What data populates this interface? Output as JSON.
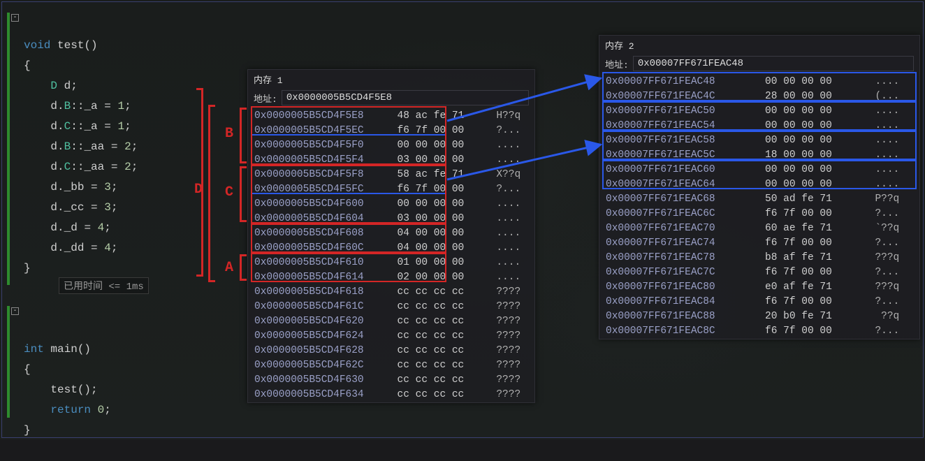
{
  "code": {
    "fn1_sig_kw": "void",
    "fn1_sig_name": "test",
    "lines": [
      "D d;",
      "d.B::_a = 1;",
      "d.C::_a = 1;",
      "d.B::_aa = 2;",
      "d.C::_aa = 2;",
      "d._bb = 3;",
      "d._cc = 3;",
      "d._d = 4;",
      "d._dd = 4;"
    ],
    "fn2_sig_kw": "int",
    "fn2_sig_name": "main",
    "main_call": "test();",
    "main_ret_kw": "return",
    "main_ret_val": "0",
    "timing": "已用时间 <= 1ms"
  },
  "labels": {
    "B": "B",
    "C": "C",
    "D": "D",
    "A": "A"
  },
  "mem1": {
    "title": "内存 1",
    "addr_label": "地址:",
    "addr_value": "0x0000005B5CD4F5E8",
    "rows": [
      {
        "a": "0x0000005B5CD4F5E8",
        "b": "48 ac fe 71",
        "s": "H??q"
      },
      {
        "a": "0x0000005B5CD4F5EC",
        "b": "f6 7f 00 00",
        "s": "?..."
      },
      {
        "a": "0x0000005B5CD4F5F0",
        "b": "00 00 00 00",
        "s": "...."
      },
      {
        "a": "0x0000005B5CD4F5F4",
        "b": "03 00 00 00",
        "s": "...."
      },
      {
        "a": "0x0000005B5CD4F5F8",
        "b": "58 ac fe 71",
        "s": "X??q"
      },
      {
        "a": "0x0000005B5CD4F5FC",
        "b": "f6 7f 00 00",
        "s": "?..."
      },
      {
        "a": "0x0000005B5CD4F600",
        "b": "00 00 00 00",
        "s": "...."
      },
      {
        "a": "0x0000005B5CD4F604",
        "b": "03 00 00 00",
        "s": "...."
      },
      {
        "a": "0x0000005B5CD4F608",
        "b": "04 00 00 00",
        "s": "...."
      },
      {
        "a": "0x0000005B5CD4F60C",
        "b": "04 00 00 00",
        "s": "...."
      },
      {
        "a": "0x0000005B5CD4F610",
        "b": "01 00 00 00",
        "s": "...."
      },
      {
        "a": "0x0000005B5CD4F614",
        "b": "02 00 00 00",
        "s": "...."
      },
      {
        "a": "0x0000005B5CD4F618",
        "b": "cc cc cc cc",
        "s": "????"
      },
      {
        "a": "0x0000005B5CD4F61C",
        "b": "cc cc cc cc",
        "s": "????"
      },
      {
        "a": "0x0000005B5CD4F620",
        "b": "cc cc cc cc",
        "s": "????"
      },
      {
        "a": "0x0000005B5CD4F624",
        "b": "cc cc cc cc",
        "s": "????"
      },
      {
        "a": "0x0000005B5CD4F628",
        "b": "cc cc cc cc",
        "s": "????"
      },
      {
        "a": "0x0000005B5CD4F62C",
        "b": "cc cc cc cc",
        "s": "????"
      },
      {
        "a": "0x0000005B5CD4F630",
        "b": "cc cc cc cc",
        "s": "????"
      },
      {
        "a": "0x0000005B5CD4F634",
        "b": "cc cc cc cc",
        "s": "????"
      }
    ]
  },
  "mem2": {
    "title": "内存 2",
    "addr_label": "地址:",
    "addr_value": "0x00007FF671FEAC48",
    "rows": [
      {
        "a": "0x00007FF671FEAC48",
        "b": "00 00 00 00",
        "s": "...."
      },
      {
        "a": "0x00007FF671FEAC4C",
        "b": "28 00 00 00",
        "s": "(..."
      },
      {
        "a": "0x00007FF671FEAC50",
        "b": "00 00 00 00",
        "s": "...."
      },
      {
        "a": "0x00007FF671FEAC54",
        "b": "00 00 00 00",
        "s": "...."
      },
      {
        "a": "0x00007FF671FEAC58",
        "b": "00 00 00 00",
        "s": "...."
      },
      {
        "a": "0x00007FF671FEAC5C",
        "b": "18 00 00 00",
        "s": "...."
      },
      {
        "a": "0x00007FF671FEAC60",
        "b": "00 00 00 00",
        "s": "...."
      },
      {
        "a": "0x00007FF671FEAC64",
        "b": "00 00 00 00",
        "s": "...."
      },
      {
        "a": "0x00007FF671FEAC68",
        "b": "50 ad fe 71",
        "s": "P??q"
      },
      {
        "a": "0x00007FF671FEAC6C",
        "b": "f6 7f 00 00",
        "s": "?..."
      },
      {
        "a": "0x00007FF671FEAC70",
        "b": "60 ae fe 71",
        "s": "`??q"
      },
      {
        "a": "0x00007FF671FEAC74",
        "b": "f6 7f 00 00",
        "s": "?..."
      },
      {
        "a": "0x00007FF671FEAC78",
        "b": "b8 af fe 71",
        "s": "???q"
      },
      {
        "a": "0x00007FF671FEAC7C",
        "b": "f6 7f 00 00",
        "s": "?..."
      },
      {
        "a": "0x00007FF671FEAC80",
        "b": "e0 af fe 71",
        "s": "???q"
      },
      {
        "a": "0x00007FF671FEAC84",
        "b": "f6 7f 00 00",
        "s": "?..."
      },
      {
        "a": "0x00007FF671FEAC88",
        "b": "20 b0 fe 71",
        "s": " ??q"
      },
      {
        "a": "0x00007FF671FEAC8C",
        "b": "f6 7f 00 00",
        "s": "?..."
      }
    ]
  },
  "colors": {
    "blue": "#2a58e8",
    "red": "#d32626"
  }
}
